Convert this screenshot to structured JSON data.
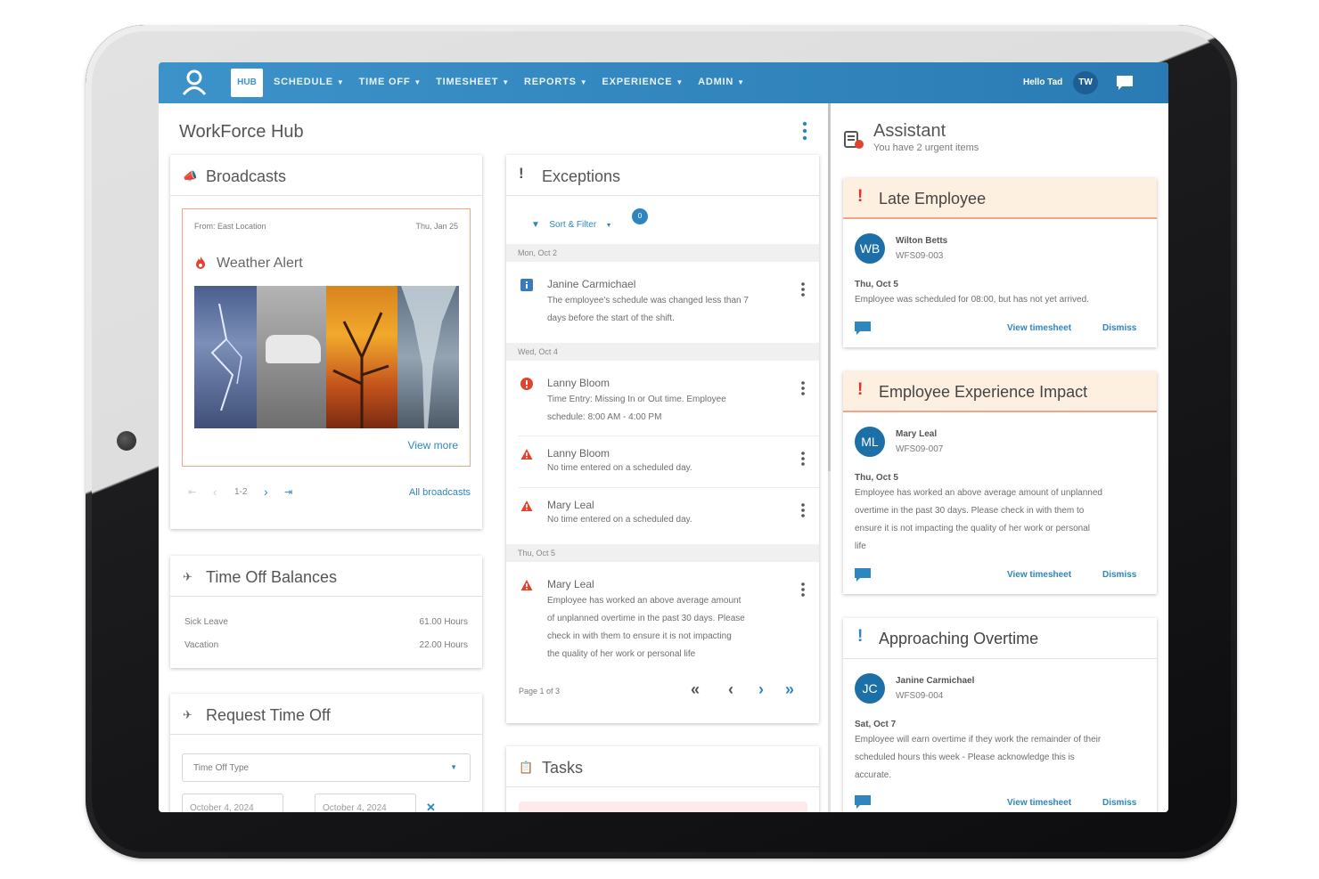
{
  "nav": {
    "hub_badge": "HUB",
    "menu": [
      "SCHEDULE",
      "TIME OFF",
      "TIMESHEET",
      "REPORTS",
      "EXPERIENCE",
      "ADMIN"
    ],
    "greeting": "Hello Tad",
    "user_initials": "TW"
  },
  "page": {
    "title": "WorkForce Hub"
  },
  "broadcasts": {
    "title": "Broadcasts",
    "from": "From: East Location",
    "date": "Thu, Jan 25",
    "alert_title": "Weather Alert",
    "view_more": "View more",
    "pager": "1-2",
    "all_link": "All broadcasts"
  },
  "time_off_balances": {
    "title": "Time Off Balances",
    "rows": [
      {
        "label": "Sick Leave",
        "value": "61.00 Hours"
      },
      {
        "label": "Vacation",
        "value": "22.00 Hours"
      }
    ]
  },
  "request_time_off": {
    "title": "Request Time Off",
    "type_placeholder": "Time Off Type",
    "start_date": "October 4, 2024",
    "end_date": "October 4, 2024"
  },
  "exceptions": {
    "title": "Exceptions",
    "sort_filter": "Sort & Filter",
    "filter_count": "0",
    "groups": [
      {
        "date": "Mon, Oct 2"
      },
      {
        "date": "Wed, Oct 4"
      },
      {
        "date": "Thu, Oct 5"
      }
    ],
    "items": [
      {
        "name": "Janine Carmichael",
        "desc": [
          "The employee's schedule was changed less than 7",
          "days before the start of the shift."
        ],
        "icon": "info-icon",
        "color": "#3a7bc0"
      },
      {
        "name": "Lanny Bloom",
        "desc": [
          "Time Entry: Missing In or Out time. Employee",
          "schedule: 8:00 AM - 4:00 PM"
        ],
        "icon": "error-icon",
        "color": "#e0442f"
      },
      {
        "name": "Lanny Bloom",
        "desc": [
          "No time entered on a scheduled day."
        ],
        "icon": "warning-icon",
        "color": "#e0442f"
      },
      {
        "name": "Mary Leal",
        "desc": [
          "No time entered on a scheduled day."
        ],
        "icon": "warning-icon",
        "color": "#e0442f"
      },
      {
        "name": "Mary Leal",
        "desc": [
          "Employee has worked an above average amount",
          "of unplanned overtime in the past 30 days. Please",
          "check in with them to ensure it is not impacting",
          "the quality of her work or personal life"
        ],
        "icon": "warning-icon",
        "color": "#e0442f"
      }
    ],
    "page_info": "Page 1 of 3"
  },
  "tasks": {
    "title": "Tasks"
  },
  "assistant": {
    "title": "Assistant",
    "subtitle": "You have 2 urgent items",
    "view_link": "View timesheet",
    "dismiss_link": "Dismiss",
    "cards": [
      {
        "title": "Late Employee",
        "initials": "WB",
        "name": "Wilton Betts",
        "id": "WFS09-003",
        "date": "Thu, Oct 5",
        "desc": [
          "Employee was scheduled for 08:00, but has not yet arrived."
        ]
      },
      {
        "title": "Employee Experience Impact",
        "initials": "ML",
        "name": "Mary Leal",
        "id": "WFS09-007",
        "date": "Thu, Oct 5",
        "desc": [
          "Employee has worked an above average amount of unplanned",
          "overtime in the past 30 days. Please check in with them to",
          "ensure it is not impacting the quality of her work or personal",
          "life"
        ]
      },
      {
        "title": "Approaching Overtime",
        "initials": "JC",
        "name": "Janine Carmichael",
        "id": "WFS09-004",
        "date": "Sat, Oct 7",
        "desc": [
          "Employee will earn overtime if they work the remainder of their",
          "scheduled hours this week - Please acknowledge this is",
          "accurate."
        ]
      }
    ]
  },
  "colors": {
    "primary": "#2e86c1",
    "nav_bar": "#3c93c9",
    "urgent": "#d9342b",
    "urgent_bg": "#fdf0e1",
    "alert_border": "#f0a58a"
  }
}
